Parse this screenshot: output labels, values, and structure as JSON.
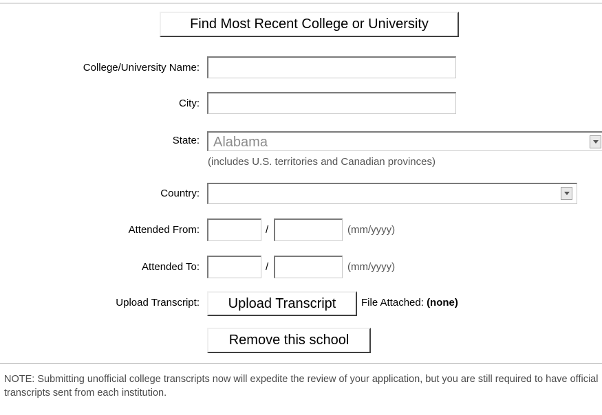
{
  "find_button": {
    "label": "Find Most Recent College or University"
  },
  "fields": {
    "college_name": {
      "label": "College/University Name:",
      "value": ""
    },
    "city": {
      "label": "City:",
      "value": ""
    },
    "state": {
      "label": "State:",
      "selected": "Alabama",
      "hint": "(includes U.S. territories and Canadian provinces)"
    },
    "country": {
      "label": "Country:",
      "selected": ""
    },
    "attended_from": {
      "label": "Attended From:",
      "month": "",
      "year": "",
      "separator": "/",
      "format_hint": "(mm/yyyy)"
    },
    "attended_to": {
      "label": "Attended To:",
      "month": "",
      "year": "",
      "separator": "/",
      "format_hint": "(mm/yyyy)"
    },
    "upload_transcript": {
      "label": "Upload Transcript:",
      "button_label": "Upload Transcript",
      "file_attached_label": "File Attached:",
      "file_attached_value": "(none)"
    }
  },
  "remove_button": {
    "label": "Remove this school"
  },
  "note": "NOTE: Submitting unofficial college transcripts now will expedite the review of your application, but you are still required to have official transcripts sent from each institution.",
  "icons": {
    "dropdown": "chevron-down-icon"
  },
  "colors": {
    "disabled_text": "#8c8c8c",
    "note_text": "#4a4a4a"
  }
}
